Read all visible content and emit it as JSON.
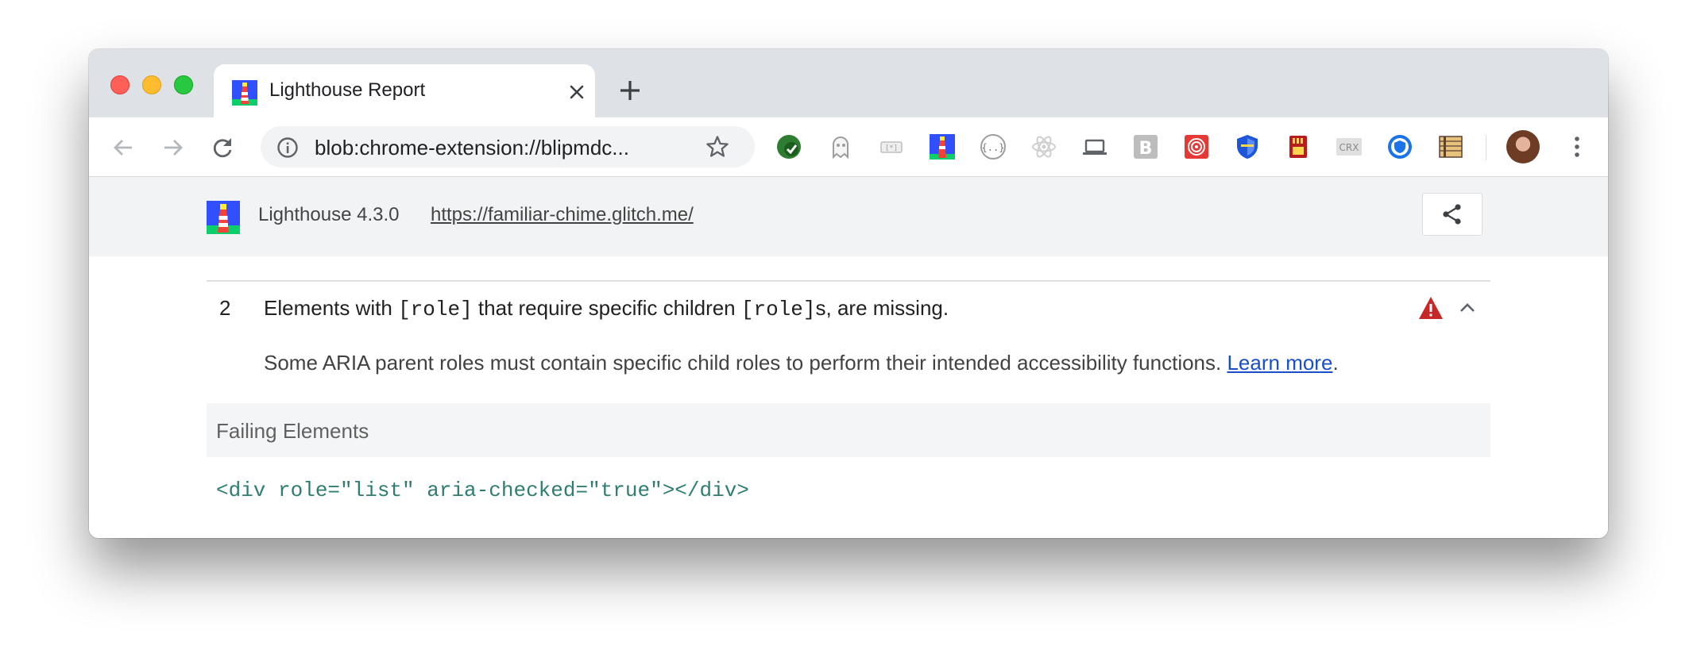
{
  "browser": {
    "tab": {
      "title": "Lighthouse Report"
    },
    "address_bar": {
      "url": "blob:chrome-extension://blipmdc..."
    },
    "extensions": [
      "green-check-icon",
      "ghost-icon",
      "tag-icon",
      "lighthouse-icon",
      "json-braces-icon",
      "react-icon",
      "laptop-icon",
      "bold-b-icon",
      "target-spiral-icon",
      "shield-icon",
      "sd-card-icon",
      "crx-icon",
      "globe-shield-icon",
      "ruler-icon"
    ],
    "crx_label": "CRX",
    "bold_label": "B"
  },
  "lighthouse": {
    "version": "Lighthouse 4.3.0",
    "url": "https://familiar-chime.glitch.me/"
  },
  "audit": {
    "index": "2",
    "title_part1": "Elements with ",
    "title_code1": "[role]",
    "title_part2": " that require specific children ",
    "title_code2": "[role]",
    "title_part3": "s, are missing.",
    "description": "Some ARIA parent roles must contain specific child roles to perform their intended accessibility functions. ",
    "learn_more": "Learn more",
    "description_end": ".",
    "status": "fail",
    "status_color": "#c62828"
  },
  "details": {
    "header": "Failing Elements",
    "items": [
      {
        "snippet": "<div role=\"list\" aria-checked=\"true\"></div>"
      }
    ]
  }
}
